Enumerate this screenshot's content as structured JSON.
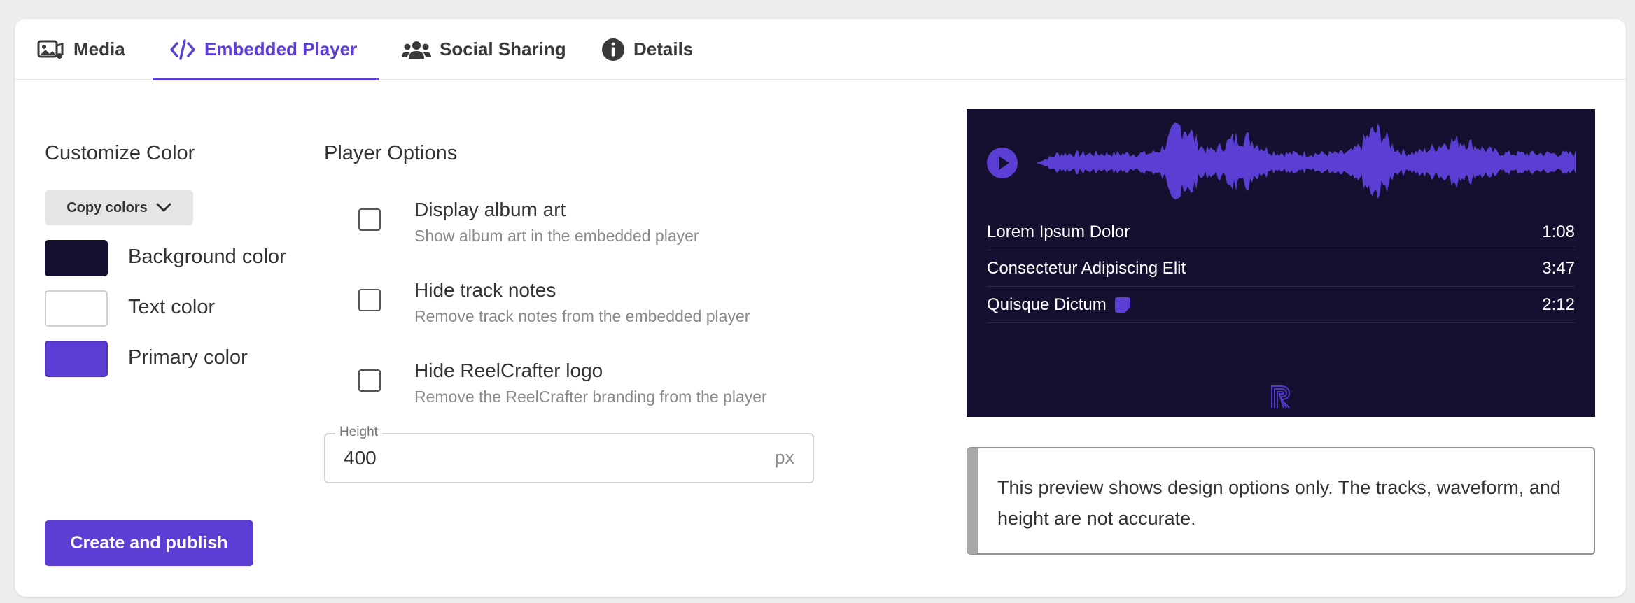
{
  "tabs": [
    {
      "label": "Media",
      "icon": "media-icon"
    },
    {
      "label": "Embedded Player",
      "icon": "code-icon"
    },
    {
      "label": "Social Sharing",
      "icon": "users-icon"
    },
    {
      "label": "Details",
      "icon": "info-icon"
    }
  ],
  "active_tab": "Embedded Player",
  "customize": {
    "title": "Customize Color",
    "copy_label": "Copy colors",
    "swatches": [
      {
        "label": "Background color",
        "color": "#15102f"
      },
      {
        "label": "Text color",
        "color": "#ffffff"
      },
      {
        "label": "Primary color",
        "color": "#5b3fd4"
      }
    ]
  },
  "options": {
    "title": "Player Options",
    "items": [
      {
        "title": "Display album art",
        "desc": "Show album art in the embedded player",
        "checked": false
      },
      {
        "title": "Hide track notes",
        "desc": "Remove track notes from the embedded player",
        "checked": false
      },
      {
        "title": "Hide ReelCrafter logo",
        "desc": "Remove the ReelCrafter branding from the player",
        "checked": false
      }
    ],
    "height": {
      "label": "Height",
      "value": "400",
      "unit": "px"
    }
  },
  "publish_label": "Create and publish",
  "player": {
    "tracks": [
      {
        "title": "Lorem Ipsum Dolor",
        "duration": "1:08",
        "has_note": false
      },
      {
        "title": "Consectetur Adipiscing Elit",
        "duration": "3:47",
        "has_note": false
      },
      {
        "title": "Quisque Dictum",
        "duration": "2:12",
        "has_note": true
      }
    ]
  },
  "notice": "This preview shows design options only. The tracks, waveform, and height are not accurate."
}
